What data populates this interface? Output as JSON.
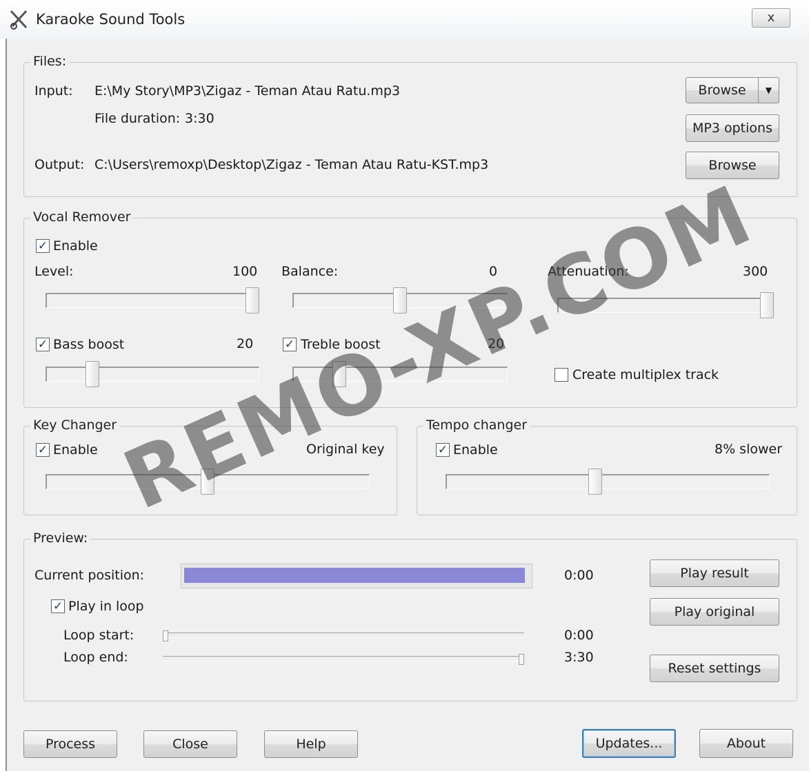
{
  "window": {
    "title": "Karaoke Sound Tools",
    "close_label": "x"
  },
  "files": {
    "legend": "Files:",
    "input_label": "Input:",
    "input_path": "E:\\My Story\\MP3\\Zigaz - Teman Atau Ratu.mp3",
    "duration_label": "File duration:",
    "duration_value": "3:30",
    "output_label": "Output:",
    "output_path": "C:\\Users\\remoxp\\Desktop\\Zigaz - Teman Atau Ratu-KST.mp3",
    "browse_input_label": "Browse",
    "dropdown_arrow": "▼",
    "mp3_options_label": "MP3 options",
    "browse_output_label": "Browse"
  },
  "vocal_remover": {
    "legend": "Vocal Remover",
    "enable_label": "Enable",
    "enable_checked": true,
    "level_label": "Level:",
    "level_value": "100",
    "level_fraction": 1.0,
    "balance_label": "Balance:",
    "balance_value": "0",
    "balance_fraction": 0.5,
    "attenuation_label": "Attenuation:",
    "attenuation_value": "300",
    "attenuation_fraction": 1.0,
    "bass_boost_label": "Bass boost",
    "bass_boost_checked": true,
    "bass_boost_value": "20",
    "bass_boost_fraction": 0.2,
    "treble_boost_label": "Treble boost",
    "treble_boost_checked": true,
    "treble_boost_value": "20",
    "treble_boost_fraction": 0.2,
    "multiplex_label": "Create multiplex track",
    "multiplex_checked": false
  },
  "key_changer": {
    "legend": "Key Changer",
    "enable_label": "Enable",
    "enable_checked": true,
    "value_text": "Original key",
    "key_fraction": 0.5
  },
  "tempo_changer": {
    "legend": "Tempo changer",
    "enable_label": "Enable",
    "enable_checked": true,
    "value_text": "8% slower",
    "tempo_fraction": 0.46
  },
  "preview": {
    "legend": "Preview:",
    "current_position_label": "Current position:",
    "current_position_value": "0:00",
    "position_fill_fraction": 1.0,
    "play_in_loop_label": "Play in loop",
    "play_in_loop_checked": true,
    "loop_start_label": "Loop start:",
    "loop_start_value": "0:00",
    "loop_end_label": "Loop end:",
    "loop_end_value": "3:30",
    "play_result_label": "Play result",
    "play_original_label": "Play original",
    "reset_settings_label": "Reset settings"
  },
  "footer": {
    "process_label": "Process",
    "close_label": "Close",
    "help_label": "Help",
    "updates_label": "Updates...",
    "about_label": "About"
  },
  "watermark": "REMO-XP.COM",
  "check_glyph": "✓"
}
